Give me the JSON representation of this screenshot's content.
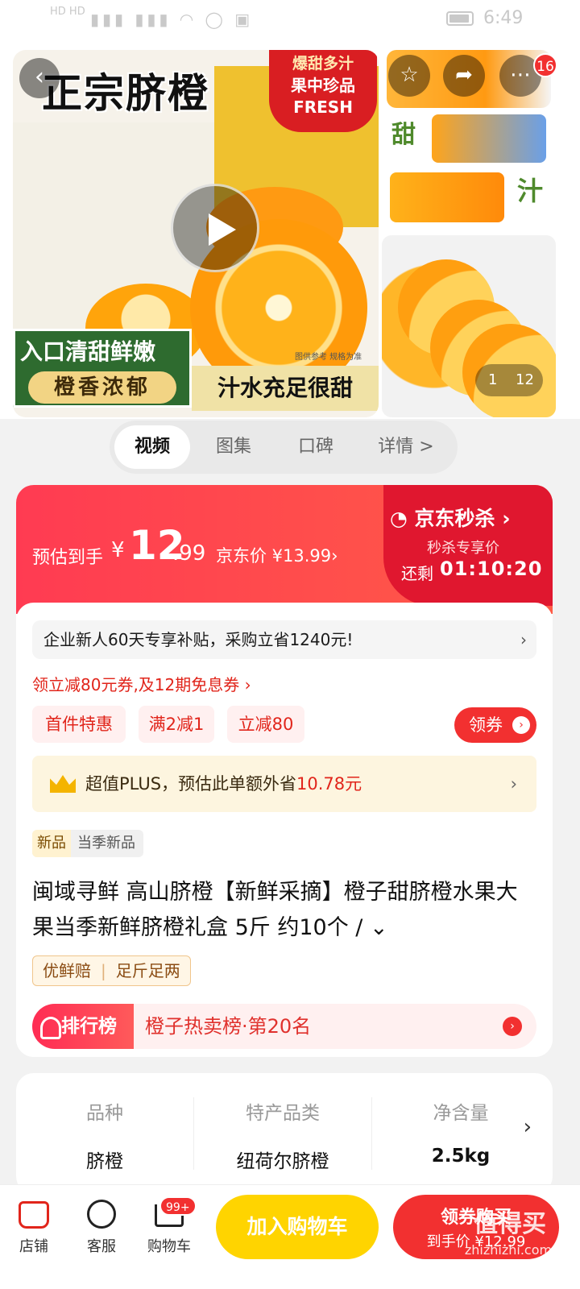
{
  "status": {
    "time": "6:49",
    "signal_glyphs": "▮▮▮ ▮▮▮ ◠ ◯ ▣",
    "carrier": "HD HD"
  },
  "gallery": {
    "hero_title": "正宗脐橙",
    "hero_tag_line1": "爆甜多汁",
    "hero_tag_line2": "果中珍品",
    "hero_tag_line3": "FRESH",
    "hero_green_line1": "入口清甜鲜嫩",
    "hero_green_line2": "橙香浓郁",
    "hero_yellow_line": "汁水充足很甜",
    "hero_note": "图供参考  规格为准",
    "thumb_char_sweet": "甜",
    "thumb_char_juice": "汁",
    "cart_count_badge": "16",
    "pager_current": "1",
    "pager_total": "12",
    "icons": {
      "back": "back-arrow-icon",
      "favorite": "star-icon",
      "share": "share-icon",
      "more": "more-dots-icon",
      "play": "play-icon"
    }
  },
  "tabs": [
    {
      "label": "视频"
    },
    {
      "label": "图集"
    },
    {
      "label": "口碑"
    },
    {
      "label": "详情 >"
    }
  ],
  "price": {
    "estimate_label": "预估到手",
    "currency": "¥",
    "integer": "12",
    "decimal": ".99",
    "jd_price": "京东价 ¥13.99",
    "jd_price_arrow": "›",
    "seckill_title": "京东秒杀",
    "seckill_subtitle": "秒杀专享价",
    "countdown_label": "还剩",
    "countdown": "01:10:20"
  },
  "promo": {
    "subsidy_text": "企业新人60天专享补贴，采购立省1240元!",
    "coupon_line": "领立减80元券,及12期免息券 ›",
    "tags": [
      "首件特惠",
      "满2减1",
      "立减80"
    ],
    "get_coupon_label": "领券",
    "plus_text": "超值PLUS，预估此单额外省",
    "plus_amount": "10.78元"
  },
  "product": {
    "new_tag": "新品",
    "new_tag_desc": "当季新品",
    "title": "闽域寻鲜 高山脐橙【新鲜采摘】橙子甜脐橙水果大果当季新鲜脐橙礼盒 5斤 约10个 / ⌄",
    "benefits": [
      "优鲜赔",
      "足斤足两"
    ],
    "rank_label": "排行榜",
    "rank_text": "橙子热卖榜·第20名"
  },
  "attributes": [
    {
      "key": "品种",
      "value": "脐橙"
    },
    {
      "key": "特产品类",
      "value": "纽荷尔脐橙"
    },
    {
      "key": "净含量",
      "value": "2.5kg"
    }
  ],
  "bottom_bar": {
    "shop_label": "店铺",
    "service_label": "客服",
    "cart_label": "购物车",
    "cart_badge": "99+",
    "add_to_cart": "加入购物车",
    "buy_line1": "领券购买",
    "buy_line2": "到手价 ¥12.99",
    "watermark": "值得买",
    "watermark_sub": "zhizhizhi.com"
  }
}
